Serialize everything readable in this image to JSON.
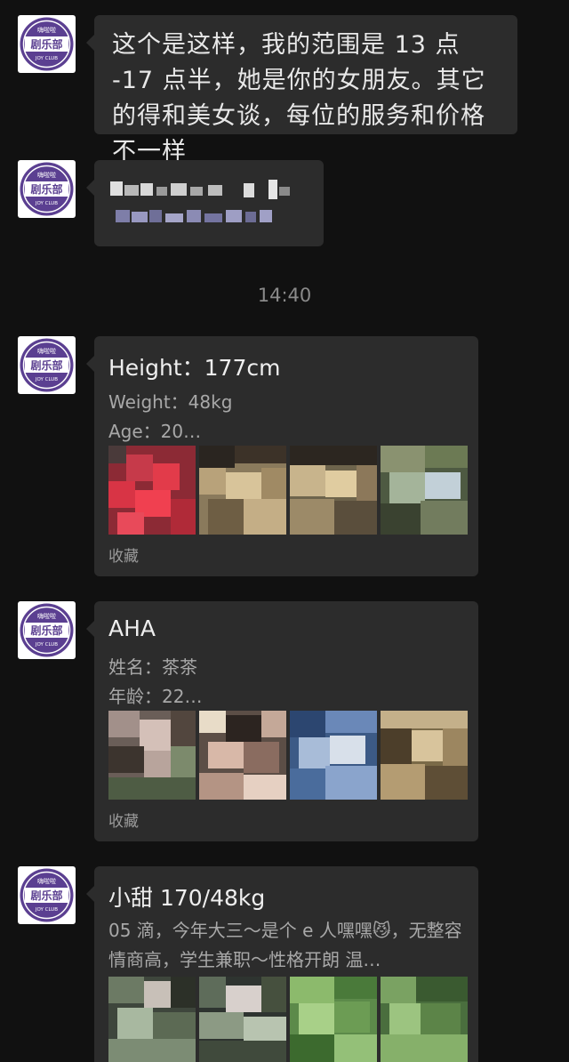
{
  "chat": {
    "avatar": {
      "brand_top": "嗨啦啦",
      "brand_main": "剧乐部",
      "brand_sub": "JOY CLUB",
      "color": "#5b3f91"
    },
    "messages": [
      {
        "type": "text",
        "text": "这个是这样，我的范围是 13 点 -17 点半，她是你的女朋友。其它的得和美女谈，每位的服务和价格不一样"
      },
      {
        "type": "redacted"
      }
    ],
    "timestamp": "14:40",
    "cards": [
      {
        "title": "Height：177cm",
        "line1": "Weight：48kg",
        "line2": "Age：20…",
        "footer": "收藏"
      },
      {
        "title": "AHA",
        "line1": "姓名：茶茶",
        "line2": "年龄：22…",
        "footer": "收藏"
      },
      {
        "title": "小甜 170/48kg",
        "desc": "05 滴，今年大三～是个 e 人嘿嘿😼，无整容情商高，学生兼职～性格开朗 温…"
      }
    ]
  },
  "colors": {
    "background": "#111111",
    "bubble": "#2c2c2c",
    "timestamp": "#8a8a8a",
    "muted_text": "#a8a8a8"
  }
}
